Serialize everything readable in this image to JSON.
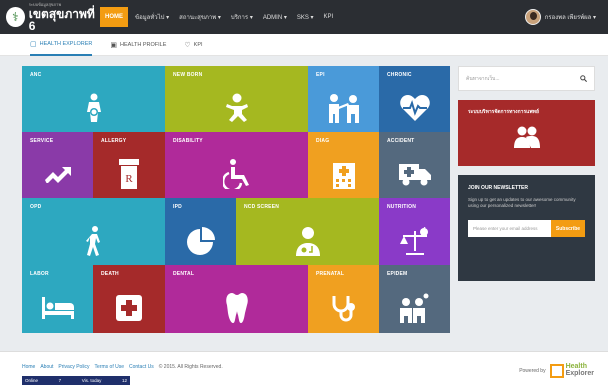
{
  "header": {
    "brand_small": "ระบบข้อมูลสุขภาพ",
    "brand_title": "เขตสุขภาพที่ 6",
    "nav": [
      {
        "label": "HOME",
        "active": true
      },
      {
        "label": "ข้อมูลทั่วไป ▾"
      },
      {
        "label": "สถานะสุขภาพ ▾"
      },
      {
        "label": "บริการ ▾"
      },
      {
        "label": "ADMIN ▾"
      },
      {
        "label": "SKS ▾"
      },
      {
        "label": "KPI"
      }
    ],
    "user_name": "กรองพล เพียรพ์ผล ▾"
  },
  "subnav": {
    "tabs": [
      {
        "label": "HEALTH EXPLORER",
        "icon": "▢",
        "active": true
      },
      {
        "label": "HEALTH PROFILE",
        "icon": "▣"
      },
      {
        "label": "KPI",
        "icon": "♡"
      }
    ]
  },
  "tiles": {
    "anc": "ANC",
    "newborn": "NEW BORN",
    "epi": "EPI",
    "chronic": "CHRONIC",
    "service": "SERVICE",
    "allergy": "ALLERGY",
    "disability": "DISABILITY",
    "diag": "DIAG",
    "accident": "ACCIDENT",
    "opd": "OPD",
    "ipd": "IPD",
    "ncd": "NCD SCREEN",
    "nutrition": "NUTRITION",
    "labor": "LABOR",
    "death": "DEATH",
    "dental": "DENTAL",
    "prenatal": "PRENATAL",
    "epidem": "EPIDEM"
  },
  "sidebar": {
    "search_placeholder": "ค้นหาจากเว็บ...",
    "ad_title": "ระบบบริหารจัดการทางการแพทย์",
    "newsletter_title": "JOIN OUR NEWSLETTER",
    "newsletter_desc": "Sign up to get an updates to our awesome community using our personalized newsletter!",
    "email_placeholder": "Please enter your email address",
    "subscribe_label": "Subscribe"
  },
  "footer": {
    "links": [
      "Home",
      "About",
      "Privacy Policy",
      "Terms of Use",
      "Contact Us"
    ],
    "copyright": "© 2015. All Rights Reserved.",
    "counter_online_label": "Online",
    "counter_online_value": "7",
    "counter_today_label": "Vis. today",
    "counter_today_value": "12",
    "powered_by": "Powered by",
    "logo_line1": "Health",
    "logo_line2": "Explorer"
  },
  "colors": {
    "topbar": "#2b2e33",
    "accent": "#f39c12",
    "teal": "#2da8c0",
    "olive": "#a5b820",
    "blue": "#4a9ad9",
    "darkblue": "#2a6aa8",
    "purple": "#8a3aa8",
    "darkred": "#a52a2a",
    "magenta": "#b02a9a",
    "orange": "#f0a020",
    "slate": "#54697e",
    "violet": "#8a3ac8"
  }
}
